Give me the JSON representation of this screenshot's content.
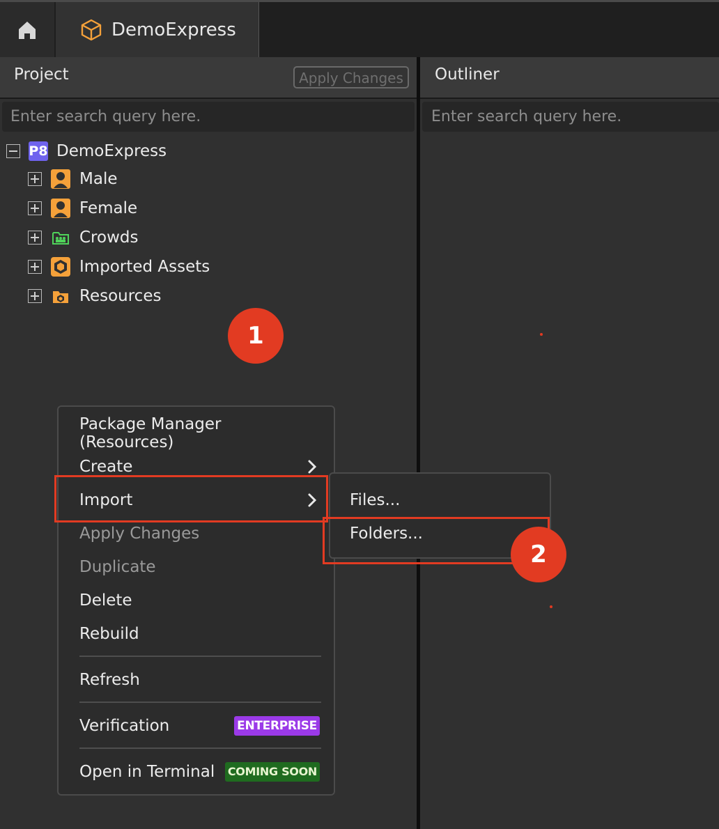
{
  "tabs": {
    "home_icon": "home-icon",
    "document_icon": "cube-icon",
    "document_label": "DemoExpress"
  },
  "project": {
    "title": "Project",
    "apply_changes": "Apply Changes",
    "search_placeholder": "Enter search query here.",
    "tree": [
      {
        "label": "DemoExpress",
        "icon": "p8-project-icon",
        "expanded": true
      },
      {
        "label": "Male",
        "icon": "person-icon",
        "expanded": false
      },
      {
        "label": "Female",
        "icon": "person-icon",
        "expanded": false
      },
      {
        "label": "Crowds",
        "icon": "crowd-folder-icon",
        "expanded": false
      },
      {
        "label": "Imported Assets",
        "icon": "hexagon-icon",
        "expanded": false
      },
      {
        "label": "Resources",
        "icon": "resource-folder-icon",
        "expanded": false
      }
    ],
    "root_badge": "P8"
  },
  "outliner": {
    "title": "Outliner",
    "search_placeholder": "Enter search query here."
  },
  "context_menu": {
    "items": [
      {
        "label": "Package Manager (Resources)"
      },
      {
        "label": "Create"
      },
      {
        "label": "Import"
      },
      {
        "label": "Apply Changes"
      },
      {
        "label": "Duplicate"
      },
      {
        "label": "Delete"
      },
      {
        "label": "Rebuild"
      },
      {
        "label": "Refresh"
      },
      {
        "label": "Verification",
        "badge": "ENTERPRISE"
      },
      {
        "label": "Open in Terminal",
        "badge": "COMING SOON"
      }
    ]
  },
  "submenu": {
    "items": [
      {
        "label": "Files..."
      },
      {
        "label": "Folders..."
      }
    ]
  },
  "markers": [
    "1",
    "2"
  ],
  "colors": {
    "accent_red": "#e23b22",
    "enterprise_badge": "#9b3ae8",
    "coming_soon_badge": "#1f6b1f",
    "project_icon": "#6f63ee",
    "asset_orange": "#f5a13a",
    "crowd_green": "#4fd35a"
  }
}
